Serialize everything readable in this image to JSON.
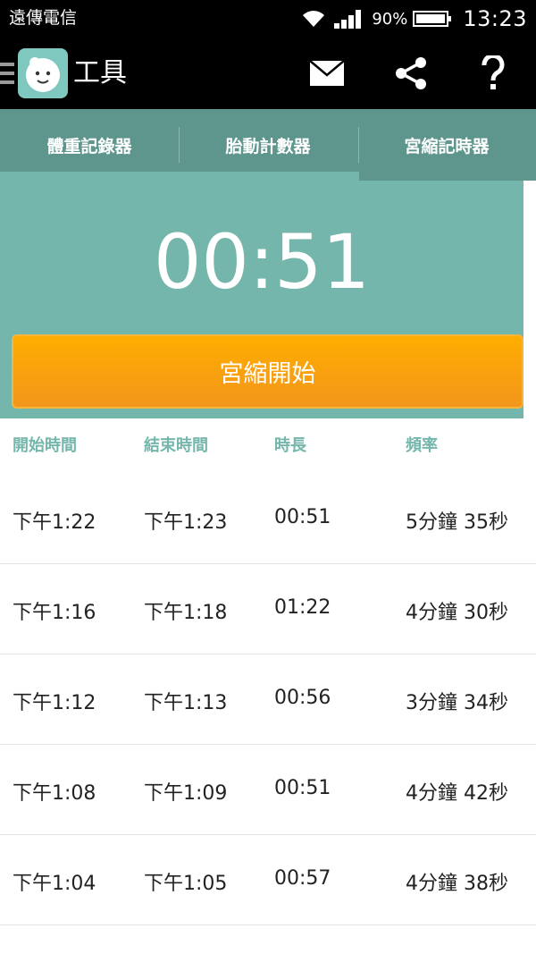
{
  "status_bar": {
    "carrier": "遠傳電信",
    "battery": "90%",
    "time": "13:23"
  },
  "action_bar": {
    "title": "工具",
    "icons": [
      "drawer-icon",
      "app-logo",
      "mail-icon",
      "share-icon",
      "help-icon"
    ]
  },
  "tabs": [
    {
      "label": "體重記錄器",
      "active": false
    },
    {
      "label": "胎動計數器",
      "active": false
    },
    {
      "label": "宮縮記時器",
      "active": true
    }
  ],
  "timer": {
    "display": "00:51",
    "button_label": "宮縮開始"
  },
  "table": {
    "headers": [
      "開始時間",
      "結束時間",
      "時長",
      "頻率"
    ],
    "rows": [
      [
        "下午1:22",
        "下午1:23",
        "00:51",
        "5分鐘 35秒"
      ],
      [
        "下午1:16",
        "下午1:18",
        "01:22",
        "4分鐘 30秒"
      ],
      [
        "下午1:12",
        "下午1:13",
        "00:56",
        "3分鐘 34秒"
      ],
      [
        "下午1:08",
        "下午1:09",
        "00:51",
        "4分鐘 42秒"
      ],
      [
        "下午1:04",
        "下午1:05",
        "00:57",
        "4分鐘 38秒"
      ]
    ]
  },
  "colors": {
    "accent": "#74b6ab",
    "tab_bar": "#5e968e",
    "button": "#ffa60a"
  }
}
